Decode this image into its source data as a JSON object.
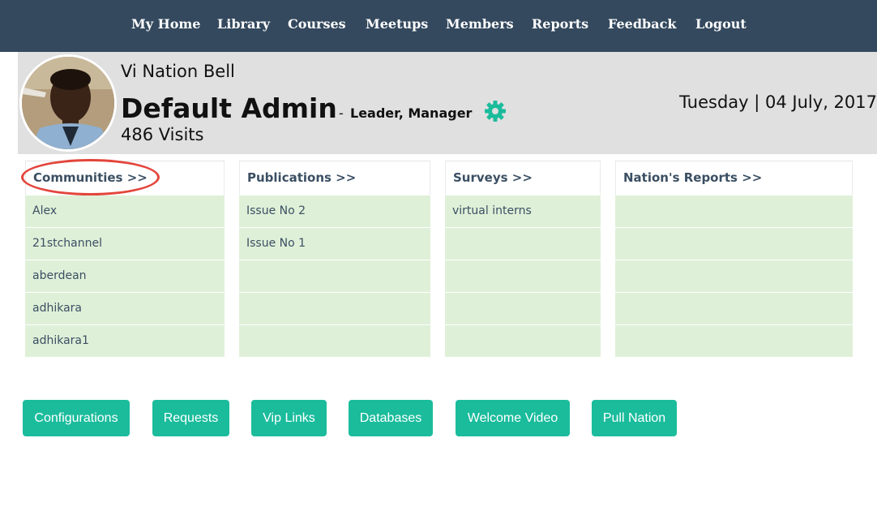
{
  "nav": {
    "items": [
      "My Home",
      "Library",
      "Courses",
      "Meetups",
      "Members",
      "Reports",
      "Feedback",
      "Logout"
    ]
  },
  "header": {
    "nation_name": "Vi Nation Bell",
    "user_name": "Default Admin",
    "role_separator": "-",
    "role": "Leader, Manager",
    "visits": "486 Visits",
    "date": "Tuesday | 04 July, 2017"
  },
  "panels": {
    "communities": {
      "title": "Communities >>",
      "items": [
        "Alex",
        "21stchannel",
        "aberdean",
        "adhikara",
        "adhikara1"
      ]
    },
    "publications": {
      "title": "Publications >>",
      "items": [
        "Issue No 2",
        "Issue No 1"
      ]
    },
    "surveys": {
      "title": "Surveys >>",
      "items": [
        "virtual interns"
      ]
    },
    "reports": {
      "title": "Nation's Reports >>",
      "items": []
    }
  },
  "buttons": [
    "Configurations",
    "Requests",
    "Vip Links",
    "Databases",
    "Welcome Video",
    "Pull Nation"
  ],
  "colors": {
    "nav_bg": "#34495e",
    "header_bg": "#e0e0e0",
    "row_bg": "#dff0d8",
    "button_bg": "#1abc9c",
    "gear": "#1abc9c",
    "highlight": "#e3453c"
  },
  "icons": {
    "settings": "gear-icon"
  }
}
